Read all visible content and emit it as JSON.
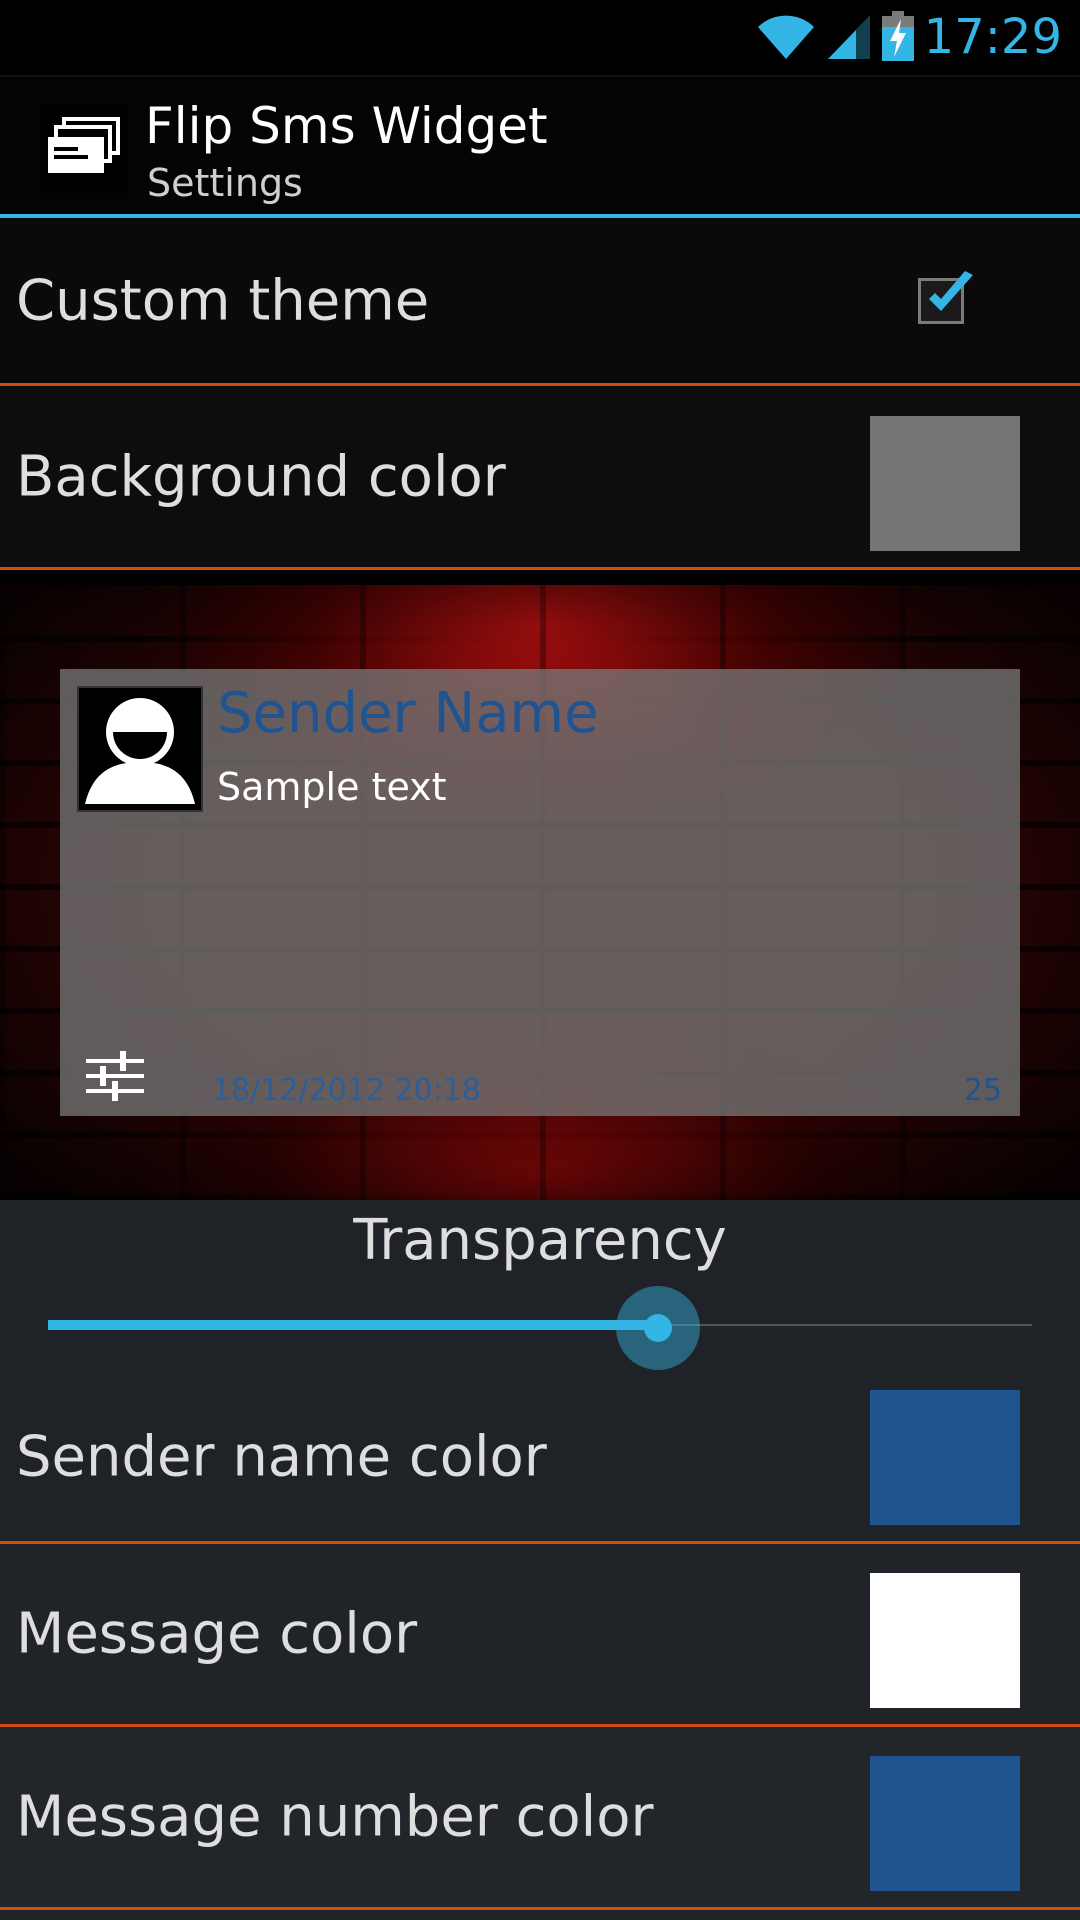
{
  "status_bar": {
    "time": "17:29",
    "icons": [
      "wifi-icon",
      "signal-icon",
      "battery-charging-icon"
    ]
  },
  "action_bar": {
    "title": "Flip Sms Widget",
    "subtitle": "Settings",
    "icon": "app-stack-icon"
  },
  "preferences": {
    "custom_theme": {
      "label": "Custom theme",
      "checked": true
    },
    "background_color": {
      "label": "Background color",
      "color": "#757575"
    },
    "transparency": {
      "label": "Transparency",
      "value_fraction": 0.62
    },
    "sender_name_color": {
      "label": "Sender name color",
      "color": "#1f5490"
    },
    "message_color": {
      "label": "Message color",
      "color": "#ffffff"
    },
    "message_number_color": {
      "label": "Message number color",
      "color": "#1f5490"
    }
  },
  "preview": {
    "sender_name": "Sender Name",
    "message": "Sample text",
    "date": "18/12/2012 20:18",
    "count": "25",
    "icons": [
      "contact-avatar-icon",
      "settings-sliders-icon"
    ]
  },
  "colors": {
    "accent": "#33b5e5",
    "divider": "#d04d12"
  }
}
